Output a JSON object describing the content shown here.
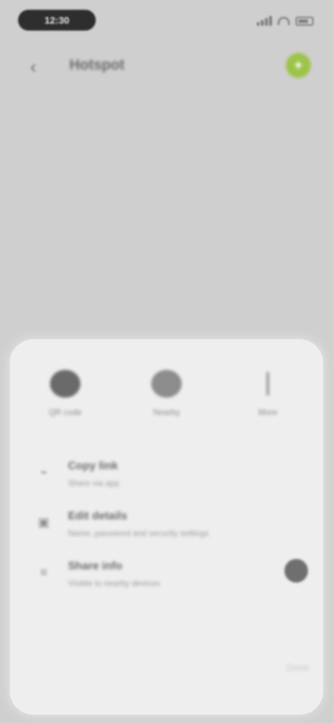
{
  "status_bar": {
    "time": "12:30",
    "icons": [
      "signal-icon",
      "wifi-icon",
      "battery-icon"
    ]
  },
  "header": {
    "back_icon": "‹",
    "title": "Hotspot",
    "action_icon": "✦"
  },
  "sheet": {
    "share_options": [
      {
        "label": "QR code",
        "icon": "qr-icon"
      },
      {
        "label": "Nearby",
        "icon": "nearby-icon"
      },
      {
        "label": "More",
        "icon": "more-icon"
      }
    ],
    "actions": [
      {
        "title": "Copy link",
        "subtitle": "Share via app",
        "icon": "link-icon"
      },
      {
        "title": "Edit details",
        "subtitle": "Name, password and security settings",
        "icon": "edit-icon"
      },
      {
        "title": "Share info",
        "subtitle": "Visible to nearby devices",
        "icon": "share-icon"
      }
    ],
    "corner_text": "Done"
  },
  "colors": {
    "backdrop": "#cfcfcf",
    "sheet": "#eeeeee",
    "accent_green": "#9cc34a",
    "dark": "#2e2e2e"
  }
}
